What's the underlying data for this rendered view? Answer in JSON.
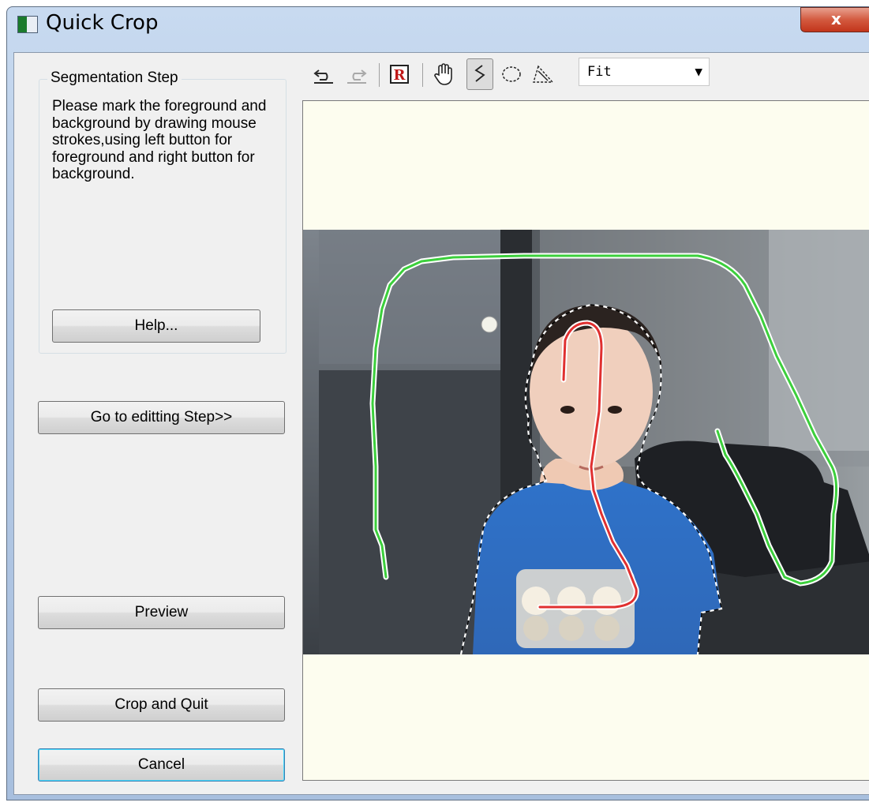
{
  "window": {
    "title": "Quick Crop",
    "close_label": "x"
  },
  "segmentation": {
    "group_title": "Segmentation Step",
    "instructions": "Please mark the foreground and background by drawing mouse strokes,using left button for foreground and right button for background.",
    "help_label": "Help..."
  },
  "buttons": {
    "editing_step": "Go to editting Step>>",
    "preview": "Preview",
    "crop_and_quit": "Crop and Quit",
    "cancel": "Cancel"
  },
  "toolbar": {
    "tools": [
      "undo-icon",
      "redo-icon",
      "reset-icon",
      "hand-icon",
      "stroke-brush-icon",
      "ellipse-select-icon",
      "polygon-select-icon"
    ],
    "active_tool": "stroke-brush-icon",
    "zoom_value": "Fit"
  },
  "canvas": {
    "background_color": "#fdfdef",
    "foreground_stroke_color": "#e03030",
    "background_stroke_color": "#3ccf3c"
  }
}
